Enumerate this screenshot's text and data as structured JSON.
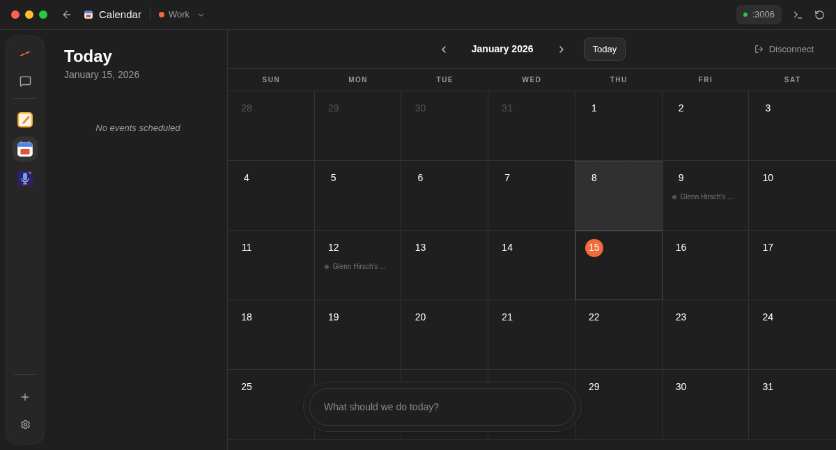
{
  "titlebar": {
    "title": "Calendar",
    "workspace": {
      "label": "Work",
      "color": "#f26b3a"
    },
    "port": {
      "label": ":3006",
      "online": true
    }
  },
  "rail": {
    "apps": [
      {
        "kind": "notes",
        "selected": false
      },
      {
        "kind": "calendar",
        "selected": true
      },
      {
        "kind": "voice",
        "selected": false
      }
    ]
  },
  "agenda": {
    "title": "Today",
    "date": "January 15, 2026",
    "empty_text": "No events scheduled"
  },
  "calendar": {
    "month": "January 2026",
    "today_button": "Today",
    "disconnect": "Disconnect",
    "weekdays": [
      "SUN",
      "MON",
      "TUE",
      "WED",
      "THU",
      "FRI",
      "SAT"
    ],
    "cells": [
      {
        "day": "28",
        "outside": true,
        "today": false,
        "highlighted": false
      },
      {
        "day": "29",
        "outside": true,
        "today": false,
        "highlighted": false
      },
      {
        "day": "30",
        "outside": true,
        "today": false,
        "highlighted": false
      },
      {
        "day": "31",
        "outside": true,
        "today": false,
        "highlighted": false
      },
      {
        "day": "1",
        "outside": false,
        "today": false,
        "highlighted": false
      },
      {
        "day": "2",
        "outside": false,
        "today": false,
        "highlighted": false
      },
      {
        "day": "3",
        "outside": false,
        "today": false,
        "highlighted": false
      },
      {
        "day": "4",
        "outside": false,
        "today": false,
        "highlighted": false
      },
      {
        "day": "5",
        "outside": false,
        "today": false,
        "highlighted": false
      },
      {
        "day": "6",
        "outside": false,
        "today": false,
        "highlighted": false
      },
      {
        "day": "7",
        "outside": false,
        "today": false,
        "highlighted": false
      },
      {
        "day": "8",
        "outside": false,
        "today": false,
        "highlighted": true
      },
      {
        "day": "9",
        "outside": false,
        "today": false,
        "highlighted": false,
        "events": [
          "Glenn Hirsch's ..."
        ]
      },
      {
        "day": "10",
        "outside": false,
        "today": false,
        "highlighted": false
      },
      {
        "day": "11",
        "outside": false,
        "today": false,
        "highlighted": false
      },
      {
        "day": "12",
        "outside": false,
        "today": false,
        "highlighted": false,
        "events": [
          "Glenn Hirsch's ..."
        ]
      },
      {
        "day": "13",
        "outside": false,
        "today": false,
        "highlighted": false
      },
      {
        "day": "14",
        "outside": false,
        "today": false,
        "highlighted": false
      },
      {
        "day": "15",
        "outside": false,
        "today": true,
        "highlighted": false
      },
      {
        "day": "16",
        "outside": false,
        "today": false,
        "highlighted": false
      },
      {
        "day": "17",
        "outside": false,
        "today": false,
        "highlighted": false
      },
      {
        "day": "18",
        "outside": false,
        "today": false,
        "highlighted": false
      },
      {
        "day": "19",
        "outside": false,
        "today": false,
        "highlighted": false
      },
      {
        "day": "20",
        "outside": false,
        "today": false,
        "highlighted": false
      },
      {
        "day": "21",
        "outside": false,
        "today": false,
        "highlighted": false
      },
      {
        "day": "22",
        "outside": false,
        "today": false,
        "highlighted": false
      },
      {
        "day": "23",
        "outside": false,
        "today": false,
        "highlighted": false
      },
      {
        "day": "24",
        "outside": false,
        "today": false,
        "highlighted": false
      },
      {
        "day": "25",
        "outside": false,
        "today": false,
        "highlighted": false
      },
      {
        "today": false,
        "highlighted": false
      },
      {
        "today": false,
        "highlighted": false
      },
      {
        "today": false,
        "highlighted": false
      },
      {
        "day": "29",
        "outside": false,
        "today": false,
        "highlighted": false
      },
      {
        "day": "30",
        "outside": false,
        "today": false,
        "highlighted": false
      },
      {
        "day": "31",
        "outside": false,
        "today": false,
        "highlighted": false
      }
    ]
  },
  "composer": {
    "placeholder": "What should we do today?"
  }
}
